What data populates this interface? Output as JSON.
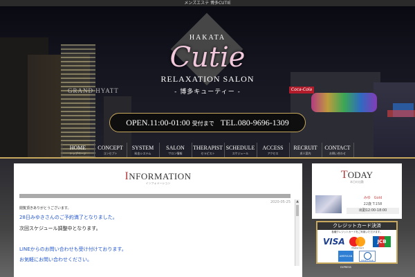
{
  "top_strip": "メンズエステ 博多CUTIE",
  "hero": {
    "logo_top": "HAKATA",
    "logo_main": "Cutie",
    "logo_sub": "RELAXATION SALON",
    "logo_jp": "- 博多キューティー -",
    "building_sign": "GRAND HYATT",
    "neon_sign": "Coca-Cola"
  },
  "hours": {
    "open_label": "OPEN.",
    "open_time": "11:00-01:00",
    "reception": "受付まで",
    "tel_label": "TEL.",
    "tel": "080-9696-1309"
  },
  "nav": [
    {
      "en": "HOME",
      "jp": "トップページ"
    },
    {
      "en": "CONCEPT",
      "jp": "コンセプト"
    },
    {
      "en": "SYSTEM",
      "jp": "料金システム"
    },
    {
      "en": "SALON",
      "jp": "サロン情報"
    },
    {
      "en": "THERAPIST",
      "jp": "セラピスト"
    },
    {
      "en": "SCHEDULE",
      "jp": "スケジュール"
    },
    {
      "en": "ACCESS",
      "jp": "アクセス"
    },
    {
      "en": "RECRUIT",
      "jp": "求人案内"
    },
    {
      "en": "CONTACT",
      "jp": "お問い合わせ"
    }
  ],
  "information": {
    "title_cap": "I",
    "title_rest": "NFORMATION",
    "subtitle": "インフォメーション",
    "date": "2020-05-25",
    "greeting": "閲覧頂きありがとうございます。",
    "line1": "28日みゆきさんのご予約満了となりました。",
    "line2": "次回スケジュール調整中となります。",
    "line3": "LINEからのお問い合わせも受け付けております。",
    "line4": "お気軽にお問い合わせください。"
  },
  "today": {
    "title_cap": "T",
    "title_rest": "ODAY",
    "subtitle": "本日の出勤",
    "therapist_name": "みゆ　Gold",
    "therapist_age": "22歳 T:158",
    "therapist_time": "出勤12:00-18:00"
  },
  "credit": {
    "heading": "クレジットカード決済",
    "note": "各種クレジットカードをご利用いただけます。",
    "visa": "VISA",
    "mastercard": "MasterCard",
    "jcb": "JCB",
    "amex": "AMERICAN EXPRESS",
    "diners": "Diners Club"
  },
  "colors": {
    "gold": "#c9a95e",
    "accent_red": "#b23a3a",
    "link_blue": "#2255cc"
  }
}
